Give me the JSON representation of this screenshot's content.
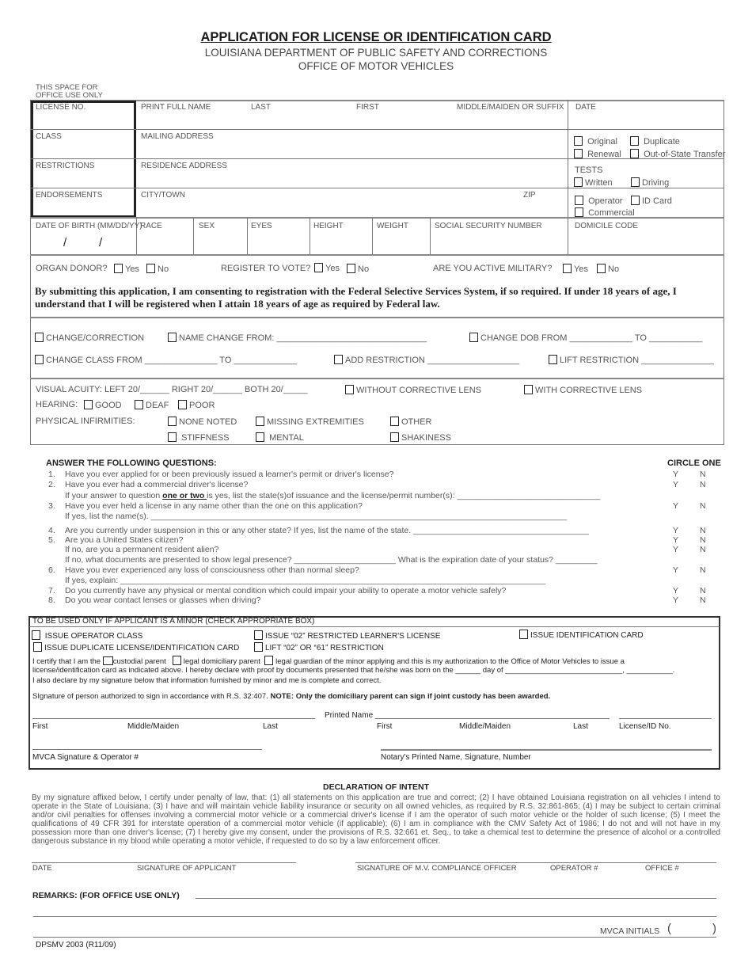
{
  "header": {
    "title": "APPLICATION FOR LICENSE OR IDENTIFICATION CARD",
    "dept": "LOUISIANA DEPARTMENT OF PUBLIC SAFETY AND CORRECTIONS",
    "office": "OFFICE OF MOTOR VEHICLES",
    "office_use_1": "THIS SPACE FOR",
    "office_use_2": "OFFICE USE ONLY"
  },
  "office_use": {
    "license_no": "LICENSE NO.",
    "class": "CLASS",
    "restrictions": "RESTRICTIONS",
    "endorsements": "ENDORSEMENTS"
  },
  "name_section": {
    "print_full_name": "PRINT FULL NAME",
    "last": "LAST",
    "first": "FIRST",
    "middle": "MIDDLE/MAIDEN OR SUFFIX",
    "mailing_address": "MAILING ADDRESS",
    "residence_address": "RESIDENCE ADDRESS",
    "city_town": "CITY/TOWN",
    "zip": "ZIP"
  },
  "right_col": {
    "date": "DATE",
    "original": "Original",
    "duplicate": "Duplicate",
    "renewal": "Renewal",
    "transfer": "Out-of-State Transfer",
    "tests": "TESTS",
    "written": "Written",
    "driving": "Driving",
    "operator": "Operator",
    "id_card": "ID Card",
    "commercial": "Commercial",
    "domicile_code": "DOMICILE CODE"
  },
  "descriptors": {
    "dob": "DATE OF BIRTH (MM/DD/YY)",
    "dob_sep": "/",
    "race": "RACE",
    "sex": "SEX",
    "eyes": "EYES",
    "height": "HEIGHT",
    "weight": "WEIGHT",
    "ssn": "SOCIAL SECURITY NUMBER"
  },
  "questions_row": {
    "organ_donor": "ORGAN DONOR?",
    "register_vote": "REGISTER TO VOTE?",
    "active_military": "ARE YOU ACTIVE MILITARY?",
    "yes": "Yes",
    "no": "No",
    "selective_service": "By submitting this application, I am consenting to registration with the Federal Selective Services System, if so required. If under 18 years of age, I understand that I will be registered when I attain 18 years of age as required by Federal law."
  },
  "changes": {
    "change_correction": "CHANGE/CORRECTION",
    "name_change": "NAME CHANGE FROM: _______________________________",
    "change_dob": "CHANGE DOB FROM _____________  TO ___________",
    "change_class": "CHANGE CLASS FROM _______________ TO _____________",
    "add_restriction": "ADD RESTRICTION ___________________",
    "lift_restriction": "LIFT RESTRICTION _______________"
  },
  "vision": {
    "acuity": "VISUAL ACUITY: LEFT 20/______   RIGHT 20/______   BOTH 20/_____",
    "without_lens": "WITHOUT CORRECTIVE LENS",
    "with_lens": "WITH CORRECTIVE LENS",
    "hearing": "HEARING:",
    "good": "GOOD",
    "deaf": "DEAF",
    "poor": "POOR",
    "infirmities": "PHYSICAL INFIRMITIES:",
    "none_noted": "NONE NOTED",
    "missing_extremities": "MISSING EXTREMITIES",
    "other": "OTHER",
    "stiffness": "STIFFNESS",
    "mental": "MENTAL",
    "shakiness": "SHAKINESS"
  },
  "questions": {
    "heading": "ANSWER THE FOLLOWING QUESTIONS:",
    "circle_one": "CIRCLE ONE",
    "y": "Y",
    "n": "N",
    "q1": "Have you ever applied for or been previously issued a learner's permit or driver's license?",
    "q2": "Have you ever had a commercial driver's license?",
    "q2a_pre": "If your answer to question ",
    "q2a_emph": "one or two ",
    "q2a_post": "is yes, list the state(s)of issuance and the license/permit number(s): _______________________________",
    "q3": "Have you ever held a license in any name other than the one on this application?",
    "q3a": "If yes, list the name(s). __________________________________________________________________________________________",
    "q4": "Are you currently under suspension in this or any other state? If yes, list the name of the state. ______________________________________",
    "q5": "Are you a United States citizen?",
    "q5a": "If no, are you a permanent resident alien?",
    "q5b": "If no, what documents are presented to show legal presence? ______________________ What is the expiration date of your status? _________",
    "q6": "Have you ever experienced any loss of consciousness other than normal sleep?",
    "q6a": "If yes, explain: ____________________________________________________________________________________________",
    "q7": "Do you currently have any physical or mental condition which could impair your ability to operate a motor vehicle safely?",
    "q8": "Do you wear contact lenses or glasses when driving?",
    "nums": [
      "1.",
      "2.",
      "3.",
      "4.",
      "5.",
      "6.",
      "7.",
      "8."
    ]
  },
  "minor": {
    "heading": "TO BE USED ONLY IF APPLICANT IS A MINOR (CHECK APPROPRIATE BOX)",
    "issue_operator": "ISSUE OPERATOR CLASS",
    "issue_02": "ISSUE “02” RESTRICTED LEARNER'S LICENSE",
    "issue_id": "ISSUE IDENTIFICATION CARD",
    "issue_duplicate": "ISSUE DUPLICATE LICENSE/IDENTIFICATION CARD",
    "lift_02": "LIFT “02” OR “61” RESTRICTION",
    "certify_pre": "I certify that I am the",
    "custodial": "custodial parent",
    "domiciliary": "legal domiciliary parent",
    "guardian_post": "legal guardian  of the minor applying and this is my authorization to the Office of Motor Vehicles to issue a",
    "line2": "license/identification card as indicated above. I hereby declare with proof by  documents presented that he/she was born on the ______ day of ____________________________, ___________.",
    "line3": "I also declare by my signature below that information furnished by minor and me is complete and correct.",
    "sig_pre": "SIgnature of person authorized to sign in accordance with R.S. 32:407. ",
    "sig_note": "NOTE: Only the domiciliary parent can sign if joint custody has been awarded.",
    "printed_name": "Printed Name",
    "first": "First",
    "middle": "Middle/Maiden",
    "last": "Last",
    "license_id": "License/ID No.",
    "mvca_sig": "MVCA Signature & Operator #",
    "notary": "Notary's Printed Name, Signature, Number"
  },
  "declaration": {
    "heading": "DECLARATION OF INTENT",
    "text": "By my signature affixed below, I certify under penalty of law, that: (1) all statements on this application are true and correct; (2) I have obtained Louisiana registration on all vehicles I intend to operate in the State of Louisiana; (3) I have and will maintain vehicle liability insurance or security on all owned vehicles, as required by R.S. 32:861-865; (4) I may be subject to certain criminal and/or civil penalties for offenses involving a commercial motor vehicle or a commercial driver's license if I am the operator of such motor vehicle or the holder of such license; (5) I meet the qualifications of 49 CFR 391 for interstate operation of a commercial motor vehicle (if applicable); (6) I am in compliance with the CMV Safety Act of 1986; I do not and will not have in my possession more than one driver's license; (7) I hereby give my consent, under the provisions of R.S. 32:661 et. Seq., to take a chemical test to determine the presence of alcohol or a controlled dangerous substance in my blood while operating a motor vehicle, if requested to do so by a law enforcement officer."
  },
  "signatures": {
    "date": "DATE",
    "applicant": "SIGNATURE OF APPLICANT",
    "officer": "SIGNATURE OF M.V. COMPLIANCE OFFICER",
    "operator": "OPERATOR #",
    "office": "OFFICE #",
    "remarks": "REMARKS: (FOR OFFICE USE ONLY)",
    "mvca_initials": "MVCA INITIALS",
    "paren_open": "(",
    "paren_close": ")",
    "form_no": "DPSMV 2003 (R11/09)"
  }
}
